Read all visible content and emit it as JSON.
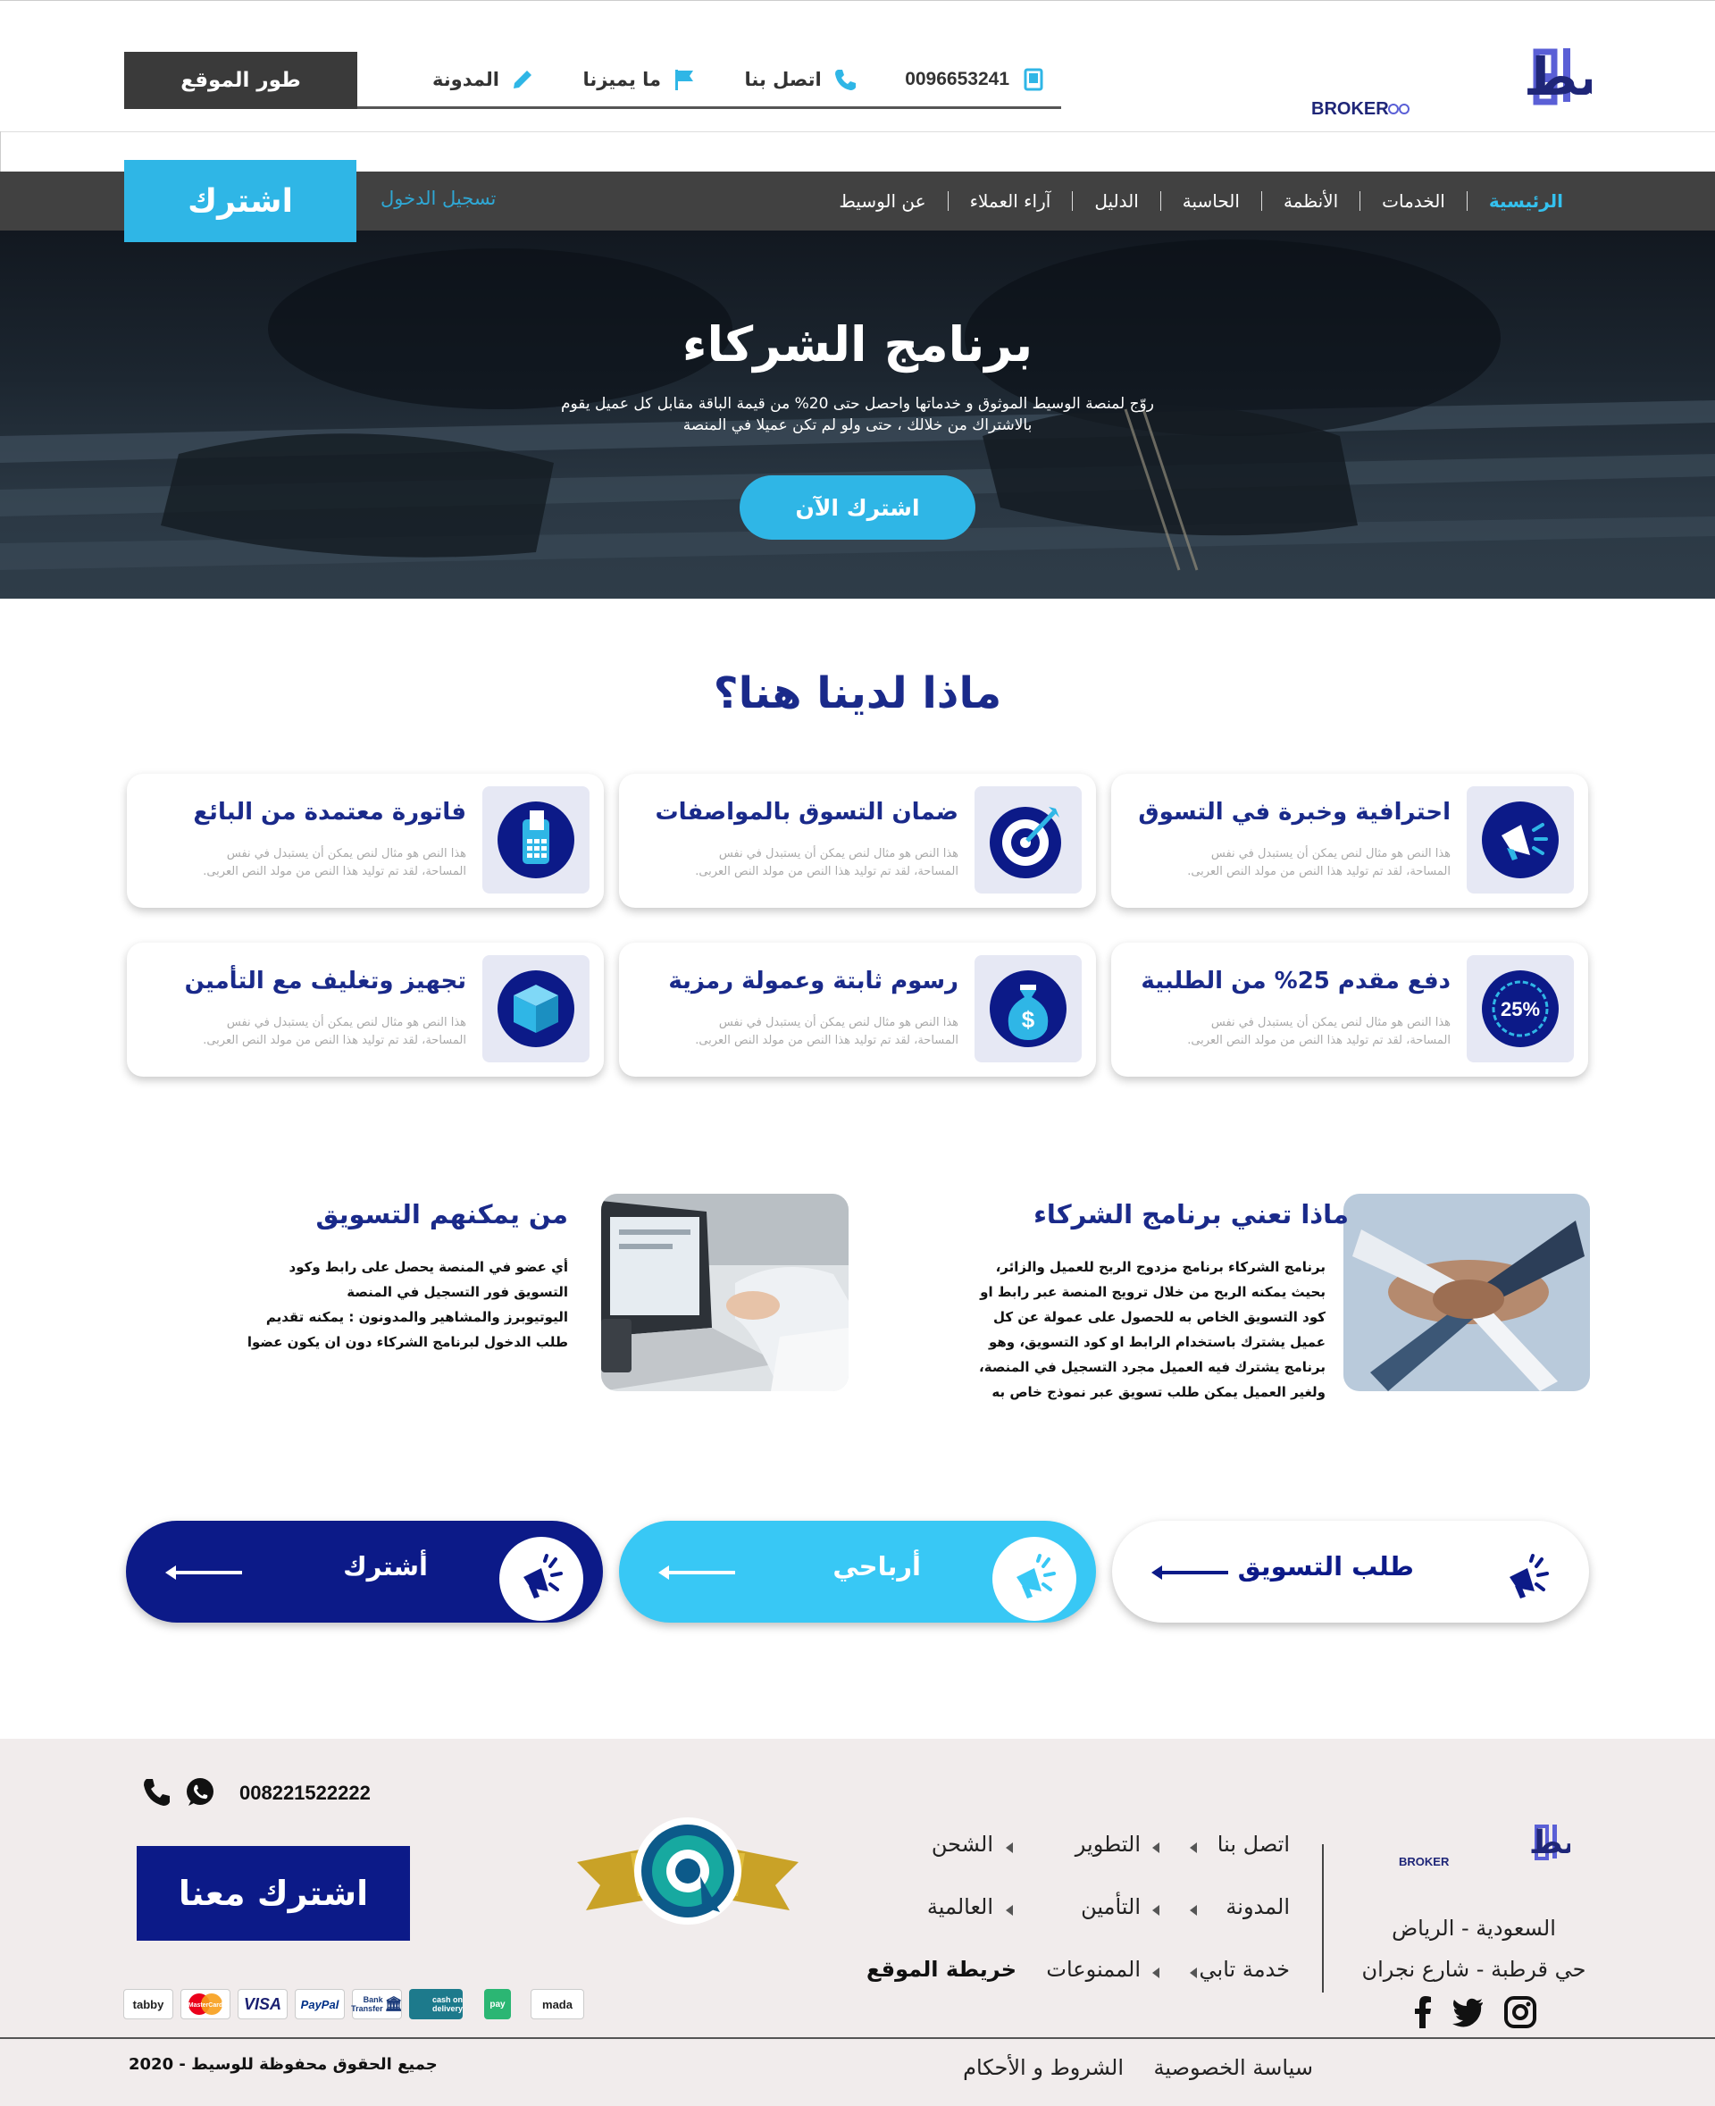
{
  "brand": {
    "name_ar": "وسط",
    "name_en": "BROKER",
    "accent": "#34c1ef",
    "navy": "#0c1a88"
  },
  "topbar": {
    "dev_button": "طور الموقع",
    "phone": "0096653241",
    "contact": "اتصل بنا",
    "features": "ما يميزنا",
    "blog": "المدونة"
  },
  "nav": {
    "items": [
      {
        "label": "الرئيسية"
      },
      {
        "label": "الخدمات"
      },
      {
        "label": "الأنظمة"
      },
      {
        "label": "الحاسبة"
      },
      {
        "label": "الدليل"
      },
      {
        "label": "آراء العملاء"
      },
      {
        "label": "عن الوسيط"
      }
    ],
    "login": "تسجيل الدخول",
    "subscribe": "اشترك"
  },
  "hero": {
    "title": "برنامج الشركاء",
    "text_line1": "روّج لمنصة الوسيط الموثوق و خدماتها واحصل حتى 20% من قيمة الباقة مقابل كل عميل يقوم",
    "text_line2": "بالاشتراك من خلالك ، حتى ولو لم تكن عميلا في المنصة",
    "button": "اشترك الآن"
  },
  "features": {
    "title": "ماذا لدينا هنا؟",
    "desc_line1": "هذا النص هو مثال لنص يمكن أن يستبدل في نفس",
    "desc_line2": "المساحة، لقد تم توليد هذا النص من مولد النص العربى.",
    "cards": [
      {
        "title": "احترافية وخبرة في التسوق",
        "icon": "megaphone-icon"
      },
      {
        "title": "ضمان التسوق بالمواصفات",
        "icon": "target-icon"
      },
      {
        "title": "فاتورة معتمدة من البائع",
        "icon": "receipt-machine-icon"
      },
      {
        "title": "دفع مقدم 25% من الطلبية",
        "icon": "percent-25-icon",
        "badge": "25%"
      },
      {
        "title": "رسوم ثابتة وعمولة رمزية",
        "icon": "money-bag-icon",
        "badge": "$"
      },
      {
        "title": "تجهيز وتغليف مع التأمين",
        "icon": "box-icon"
      }
    ]
  },
  "info": {
    "partners": {
      "title": "ماذا تعني برنامج الشركاء",
      "lines": [
        "برنامج الشركاء برنامج  مزدوج الربح  للعميل والزائر،",
        "بحيث يمكنه الربح من خلال ترويج المنصة عبر رابط او",
        "كود التسويق الخاص به للحصول على عمولة عن كل",
        "عميل يشترك باستخدام الرابط او كود التسويق، وهو",
        "برنامج يشترك فيه العميل مجرد التسجيل في المنصة،",
        "ولغير العميل يمكن طلب تسويق عبر نموذج خاص به"
      ]
    },
    "marketers": {
      "title": "من يمكنهم التسويق",
      "lines": [
        "أي عضو في المنصة يحصل على رابط وكود",
        "التسويق فور التسجيل في المنصة",
        "اليوتيوبرز والمشاهير والمدونون : يمكنه تقديم",
        "طلب الدخول لبرنامج الشركاء دون ان يكون عضوا"
      ]
    }
  },
  "actions": [
    {
      "label": "طلب التسويق",
      "bg": "#ffffff",
      "fg": "#0c1a88"
    },
    {
      "label": "أرباحي",
      "bg": "#38c8f5",
      "fg": "#ffffff"
    },
    {
      "label": "أشترك",
      "bg": "#0c1a88",
      "fg": "#ffffff"
    }
  ],
  "footer": {
    "address_line1": "السعودية - الرياض",
    "address_line2": "حي قرطبة - شارع نجران",
    "links": {
      "col1": [
        "اتصل بنا",
        "المدونة",
        "خدمة تابي"
      ],
      "col2": [
        "التطوير",
        "التأمين",
        "الممنوعات"
      ],
      "col3": [
        "الشحن",
        "العالمية"
      ]
    },
    "sitemap": "خريطة الموقع",
    "phone": "008221522222",
    "join": "اشترك معنا",
    "payments": [
      "tabby",
      "MasterCard",
      "VISA",
      "PayPal",
      "Bank Transfer",
      "cash on delivery",
      "pay",
      "mada"
    ],
    "copyright": "جميع الحقوق محفوظة للوسيط - 2020",
    "privacy": "سياسة الخصوصية",
    "terms": "الشروط و الأحكام"
  }
}
